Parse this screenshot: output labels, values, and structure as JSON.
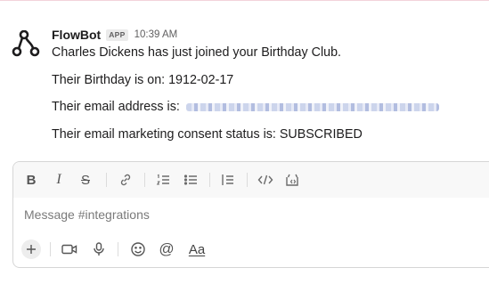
{
  "message": {
    "sender": "FlowBot",
    "badge": "APP",
    "time": "10:39 AM",
    "line1": "Charles Dickens has just joined your Birthday Club.",
    "line2": "Their Birthday is on: 1912-02-17",
    "line3_label": "Their email address is:",
    "line4": "Their email marketing consent status is: SUBSCRIBED"
  },
  "composer": {
    "placeholder": "Message #integrations",
    "toolbar_icons": [
      "bold-icon",
      "italic-icon",
      "strikethrough-icon",
      "link-icon",
      "ordered-list-icon",
      "bullet-list-icon",
      "blockquote-icon",
      "code-icon",
      "code-block-icon"
    ],
    "bottom_icons": [
      "plus-icon",
      "video-icon",
      "microphone-icon",
      "emoji-icon",
      "mention-icon",
      "formatting-icon"
    ],
    "bold_glyph": "B",
    "italic_glyph": "I",
    "strike_glyph": "S",
    "mention_glyph": "@",
    "format_label": "Aa"
  }
}
